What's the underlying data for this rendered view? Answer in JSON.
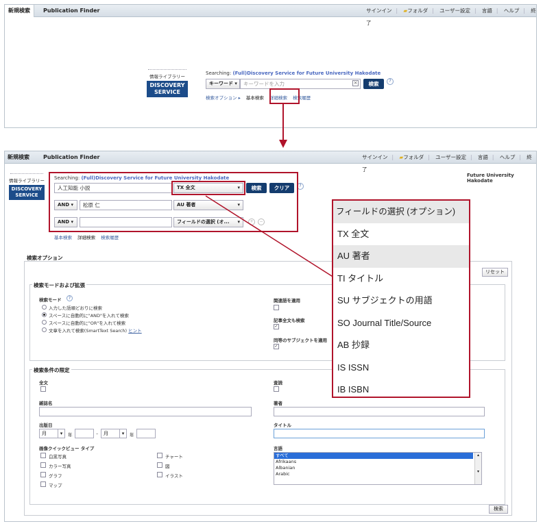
{
  "nav": {
    "tab_new_search": "新規検索",
    "tab_publication_finder": "Publication Finder",
    "sign_in": "サインイン",
    "folder": "フォルダ",
    "user_settings": "ユーザー設定",
    "language": "言語",
    "help": "ヘルプ",
    "exit": "終了"
  },
  "logo": {
    "library": "情報ライブラリー",
    "line1": "DISCOVERY",
    "line2": "SERVICE"
  },
  "top": {
    "searching_label": "Searching:",
    "searching_source": "(Full)Discovery Service for Future University Hakodate",
    "field_select": "キーワード",
    "placeholder": "キーワードを入力",
    "search_button": "検索",
    "search_options": "検索オプション ▸",
    "basic_search": "基本検索",
    "advanced_search": "詳細検索",
    "search_history": "検索履歴"
  },
  "adv": {
    "institution": "Future University Hakodate",
    "rows": [
      {
        "bool": "",
        "value": "人工知能 小説",
        "field": "TX 全文"
      },
      {
        "bool": "AND",
        "value": "松原 仁",
        "field": "AU 著者"
      },
      {
        "bool": "AND",
        "value": "",
        "field": "フィールドの選択 (オ..."
      }
    ],
    "search_button": "検索",
    "clear_button": "クリア",
    "basic_search": "基本検索",
    "advanced_search": "詳細検索",
    "search_history": "検索履歴"
  },
  "dropdown": {
    "items": [
      "フィールドの選択 (オプション)",
      "TX 全文",
      "AU 著者",
      "TI タイトル",
      "SU サブジェクトの用語",
      "SO Journal Title/Source",
      "AB 抄録",
      "IS ISSN",
      "IB ISBN"
    ]
  },
  "options": {
    "title": "検索オプション",
    "reset": "リセット",
    "modes_title": "検索モードおよび拡張",
    "mode_label": "検索モード",
    "modes": [
      "入力した語順どおりに検索",
      "スペースに自動的に\"AND\"を入れて検索",
      "スペースに自動的に\"OR\"を入れて検索",
      "文章を入れて検索(SmartText Search)"
    ],
    "hint": "ヒント",
    "related_words": "関連語を適用",
    "fulltext_search": "記事全文も検索",
    "equivalent_subjects": "同等のサブジェクトを適用",
    "limit_title": "検索条件の限定",
    "fulltext": "全文",
    "peer_review": "査読",
    "journal_name": "雑誌名",
    "author": "著者",
    "pub_date": "出版日",
    "month": "月",
    "year": "年",
    "title_label": "タイトル",
    "image_quick_view": "画像クイックビュー タイプ",
    "image_types": [
      "白黒写真",
      "カラー写真",
      "グラフ",
      "マップ",
      "チャート",
      "図",
      "イラスト"
    ],
    "language": "言語",
    "languages": [
      "すべて",
      "Afrikaans",
      "Albanian",
      "Arabic"
    ],
    "search": "検索"
  },
  "colors": {
    "accent": "#143c6e",
    "highlight_red": "#b0132a",
    "link": "#3a5fa0"
  }
}
